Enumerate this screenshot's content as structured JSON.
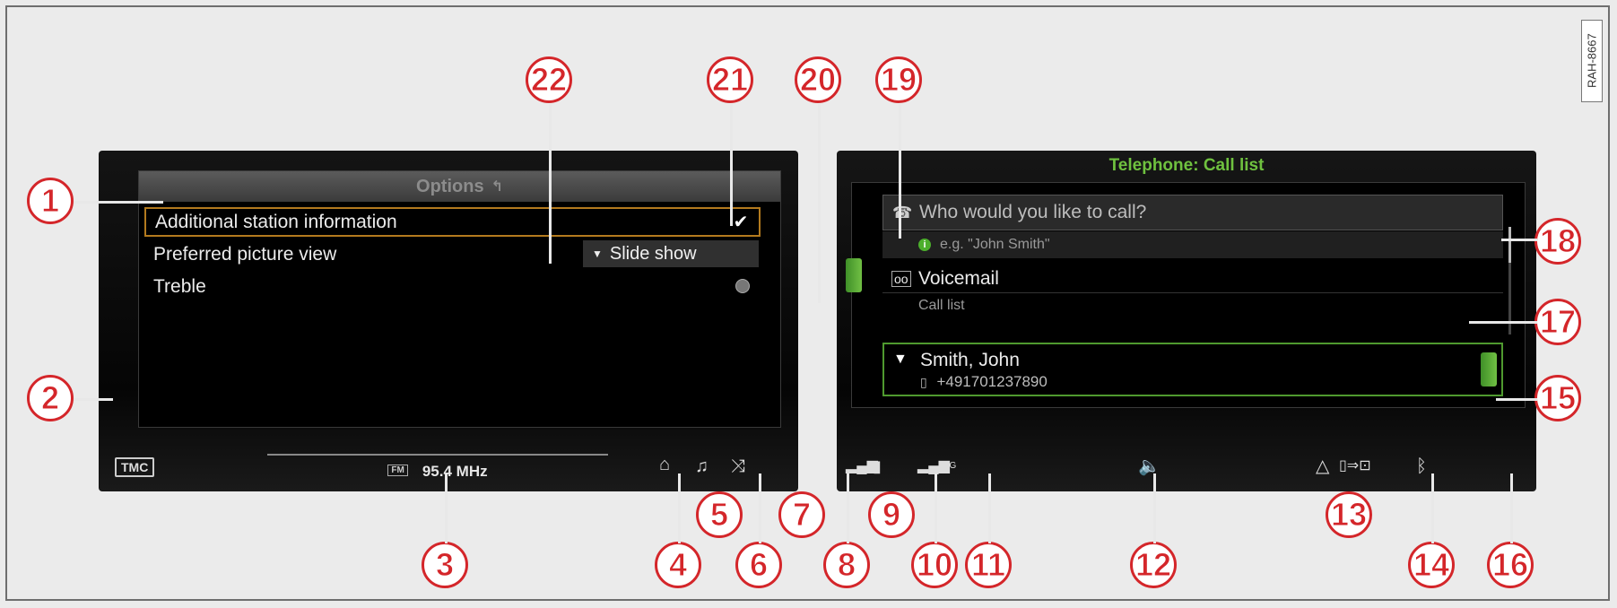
{
  "watermark": "RAH-8667",
  "left_screen": {
    "options": {
      "title": "Options",
      "rows": [
        {
          "label": "Additional station information",
          "control": "checkbox",
          "checked": true
        },
        {
          "label": "Preferred picture view",
          "control": "dropdown",
          "value": "Slide show"
        },
        {
          "label": "Treble",
          "control": "knob"
        }
      ]
    },
    "status": {
      "tmc": "TMC",
      "band_badge": "FM",
      "frequency": "95.4 MHz"
    }
  },
  "right_screen": {
    "title": "Telephone: Call list",
    "title_color": "#6fc13f",
    "search": {
      "placeholder": "Who would you like to call?",
      "hint": "e.g. \"John Smith\""
    },
    "voicemail": {
      "label": "Voicemail",
      "sublabel": "Call list"
    },
    "contact": {
      "name": "Smith, John",
      "number": "+491701237890"
    },
    "network_badge": "3G"
  },
  "callouts": [
    "1",
    "2",
    "3",
    "4",
    "5",
    "6",
    "7",
    "8",
    "9",
    "10",
    "11",
    "12",
    "13",
    "14",
    "15",
    "16",
    "17",
    "18",
    "19",
    "20",
    "21",
    "22"
  ],
  "accent_colors": {
    "callout": "#d4262a",
    "selection": "#b37a1e",
    "green": "#4caf2c"
  }
}
